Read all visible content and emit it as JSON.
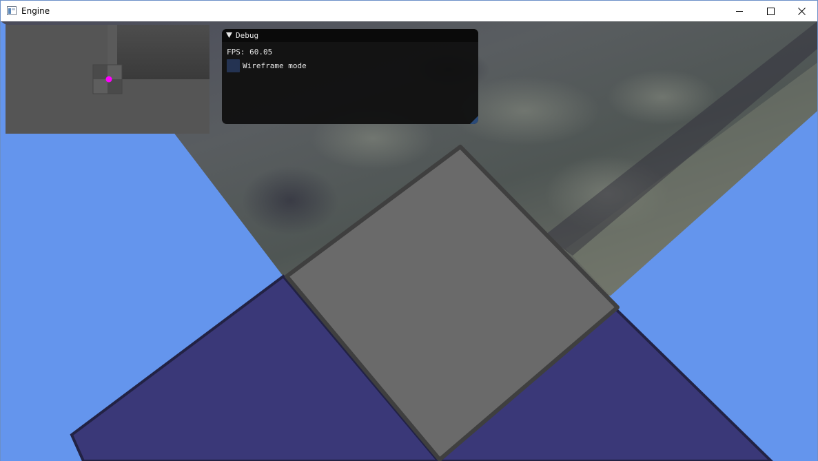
{
  "window": {
    "title": "Engine"
  },
  "debug_panel": {
    "title": "Debug",
    "fps_text": "FPS: 60.05",
    "wireframe_label": "Wireframe mode",
    "wireframe_checked": false
  },
  "colors": {
    "sky": "#6495ed",
    "floor_tile": "#3a3878",
    "box": "#6a6a6a",
    "minimap_player": "#ff00ff"
  },
  "icons": {
    "app": "app-window-icon",
    "minimize": "minimize-icon",
    "maximize": "maximize-icon",
    "close": "close-icon",
    "collapse": "triangle-down-icon"
  }
}
